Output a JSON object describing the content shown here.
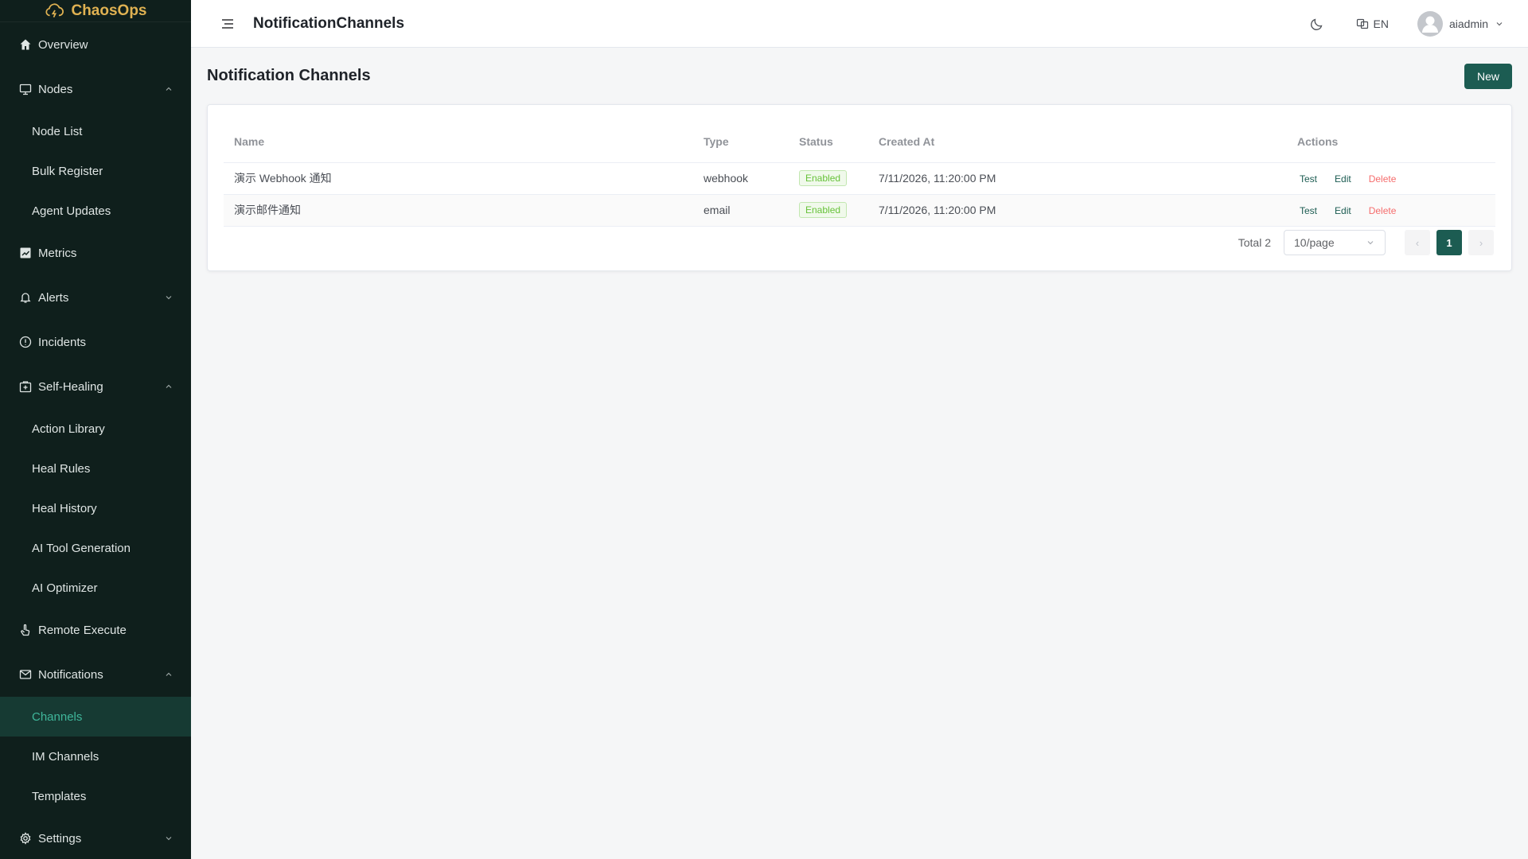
{
  "brand": {
    "name": "ChaosOps",
    "logo_icon": "cloud-bolt-icon",
    "color": "#e0b252"
  },
  "sidebar": {
    "items": [
      {
        "label": "Overview",
        "icon": "home-icon"
      },
      {
        "label": "Nodes",
        "icon": "monitor-icon",
        "expanded": true,
        "children": [
          "Node List",
          "Bulk Register",
          "Agent Updates"
        ]
      },
      {
        "label": "Metrics",
        "icon": "chart-icon"
      },
      {
        "label": "Alerts",
        "icon": "bell-icon",
        "expanded": false
      },
      {
        "label": "Incidents",
        "icon": "alert-circle-icon"
      },
      {
        "label": "Self-Healing",
        "icon": "first-aid-icon",
        "expanded": true,
        "children": [
          "Action Library",
          "Heal Rules",
          "Heal History",
          "AI Tool Generation",
          "AI Optimizer"
        ]
      },
      {
        "label": "Remote Execute",
        "icon": "pointer-icon"
      },
      {
        "label": "Notifications",
        "icon": "mail-icon",
        "expanded": true,
        "children": [
          "Channels",
          "IM Channels",
          "Templates"
        ],
        "active_child": "Channels"
      },
      {
        "label": "Settings",
        "icon": "gear-icon",
        "expanded": false
      }
    ]
  },
  "header": {
    "title": "NotificationChannels",
    "lang": "EN",
    "user": "aiadmin"
  },
  "page": {
    "title": "Notification Channels",
    "new_label": "New"
  },
  "table": {
    "columns": [
      "Name",
      "Type",
      "Status",
      "Created At",
      "Actions"
    ],
    "rows": [
      {
        "name": "演示 Webhook 通知",
        "type": "webhook",
        "status": "Enabled",
        "created_at": "7/11/2026, 11:20:00 PM"
      },
      {
        "name": "演示邮件通知",
        "type": "email",
        "status": "Enabled",
        "created_at": "7/11/2026, 11:20:00 PM"
      }
    ],
    "actions": {
      "test": "Test",
      "edit": "Edit",
      "delete": "Delete"
    }
  },
  "pagination": {
    "total_label": "Total 2",
    "page_size": "10/page",
    "current_page": "1",
    "prev": "‹",
    "next": "›"
  },
  "colors": {
    "sidebar_bg": "#0f1f1c",
    "primary": "#1c5c52",
    "active_text": "#3fb79b",
    "danger": "#f56c6c",
    "success": "#67c23a"
  }
}
